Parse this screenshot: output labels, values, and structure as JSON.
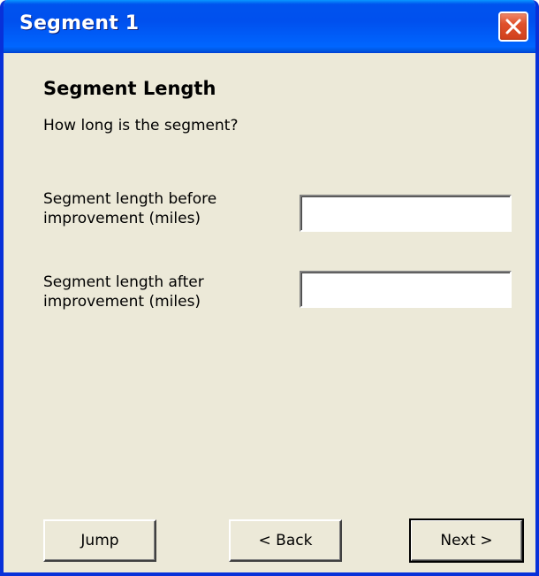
{
  "window": {
    "title": "Segment 1",
    "accent_color": "#0054e3",
    "close_icon": "close-icon"
  },
  "main": {
    "heading": "Segment Length",
    "question": "How long is the segment?",
    "fields": [
      {
        "label": "Segment length before improvement (miles)",
        "value": ""
      },
      {
        "label": "Segment length after improvement (miles)",
        "value": ""
      }
    ]
  },
  "buttons": {
    "jump": "Jump",
    "back": "< Back",
    "next": "Next >"
  }
}
